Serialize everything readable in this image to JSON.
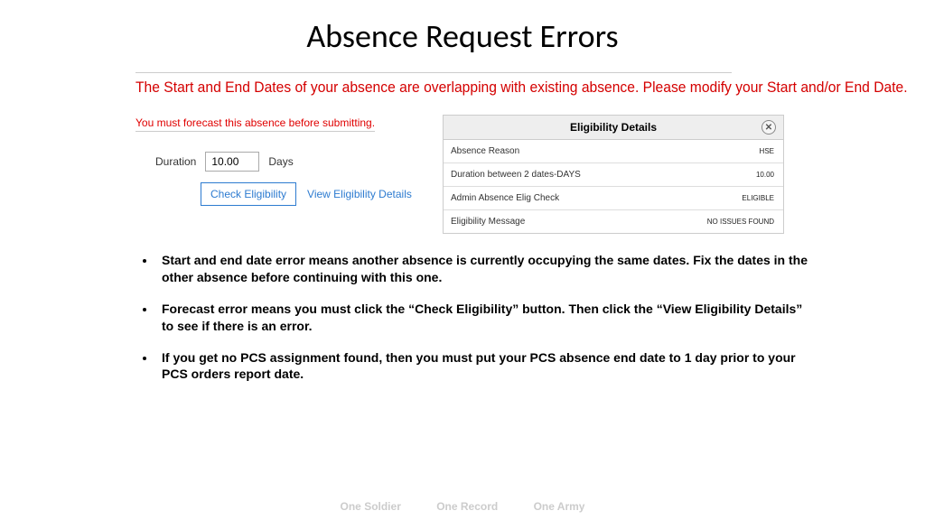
{
  "title": "Absence Request Errors",
  "error_banner": "The Start and End Dates of your absence are overlapping with existing absence. Please modify your Start and/or End Date.",
  "forecast_message": "You must forecast this absence before submitting.",
  "duration": {
    "label": "Duration",
    "value": "10.00",
    "unit": "Days"
  },
  "check_eligibility_label": "Check Eligibility",
  "view_eligibility_label": "View Eligibility Details",
  "eligibility_panel": {
    "heading": "Eligibility Details",
    "rows": [
      {
        "label": "Absence Reason",
        "value": "HSE"
      },
      {
        "label": "Duration between 2 dates-DAYS",
        "value": "10.00"
      },
      {
        "label": "Admin Absence Elig Check",
        "value": "ELIGIBLE"
      },
      {
        "label": "Eligibility Message",
        "value": "NO ISSUES FOUND"
      }
    ]
  },
  "bullets": [
    "Start and end date error means another absence is currently occupying the same dates. Fix the dates in the other absence before continuing with this one.",
    "Forecast error means you must click the “Check Eligibility” button. Then click the “View Eligibility Details” to see if there is an error.",
    "If you get no PCS assignment found, then you must put your PCS absence end date to 1 day prior to your PCS orders report date."
  ],
  "footer": {
    "left": "One Soldier",
    "mid": "One Record",
    "right": "One Army"
  }
}
